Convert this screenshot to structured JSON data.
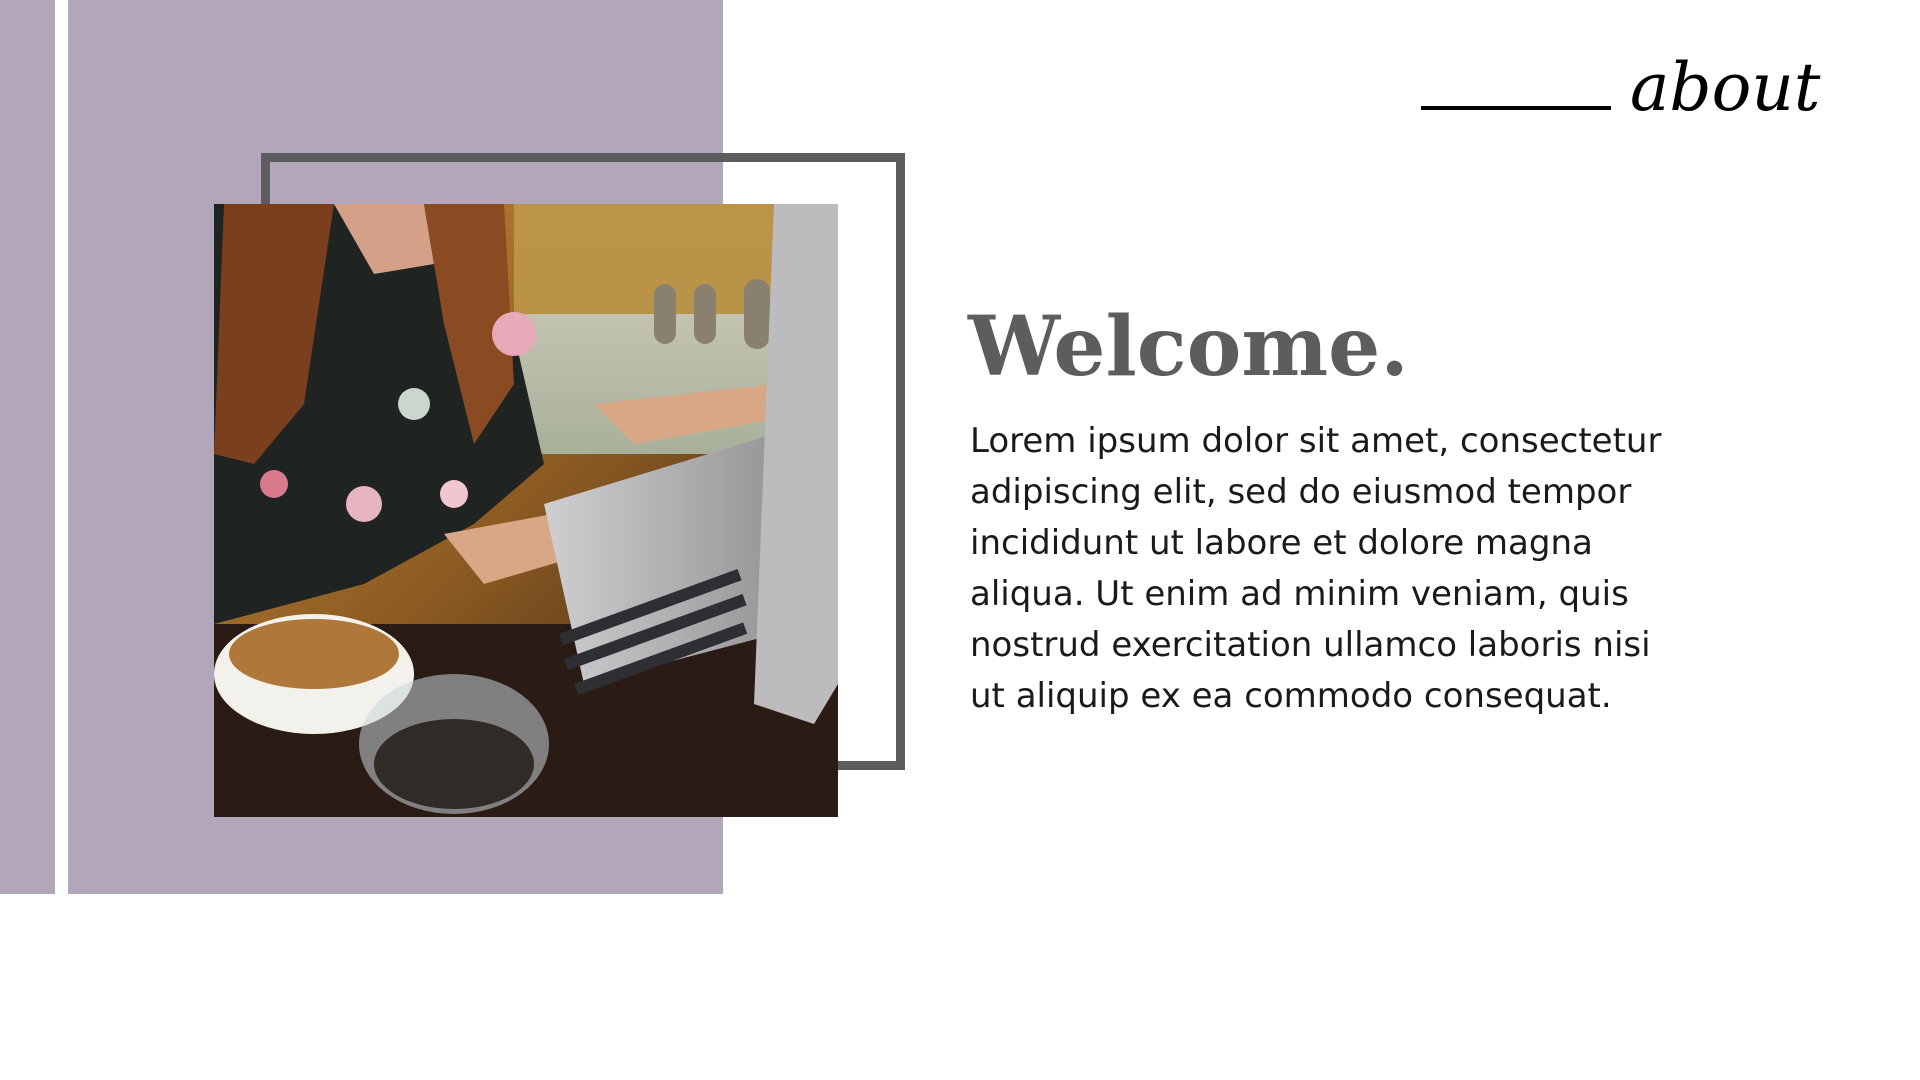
{
  "colors": {
    "panel": "#b2a7ba",
    "frame": "#5d5d5f",
    "title": "#5d5d5f",
    "body_text": "#1a1a1a",
    "background": "#ffffff"
  },
  "header": {
    "about_label": "about"
  },
  "main": {
    "title": "Welcome.",
    "body": "Lorem ipsum dolor sit amet, consectetur adipiscing elit, sed do eiusmod tempor incididunt ut labore et dolore magna aliqua. Ut enim ad minim veniam, quis nostrud exercitation ullamco laboris nisi ut aliquip ex ea commodo consequat."
  },
  "photo": {
    "icon": "woman-laptop-coffee-photo"
  }
}
